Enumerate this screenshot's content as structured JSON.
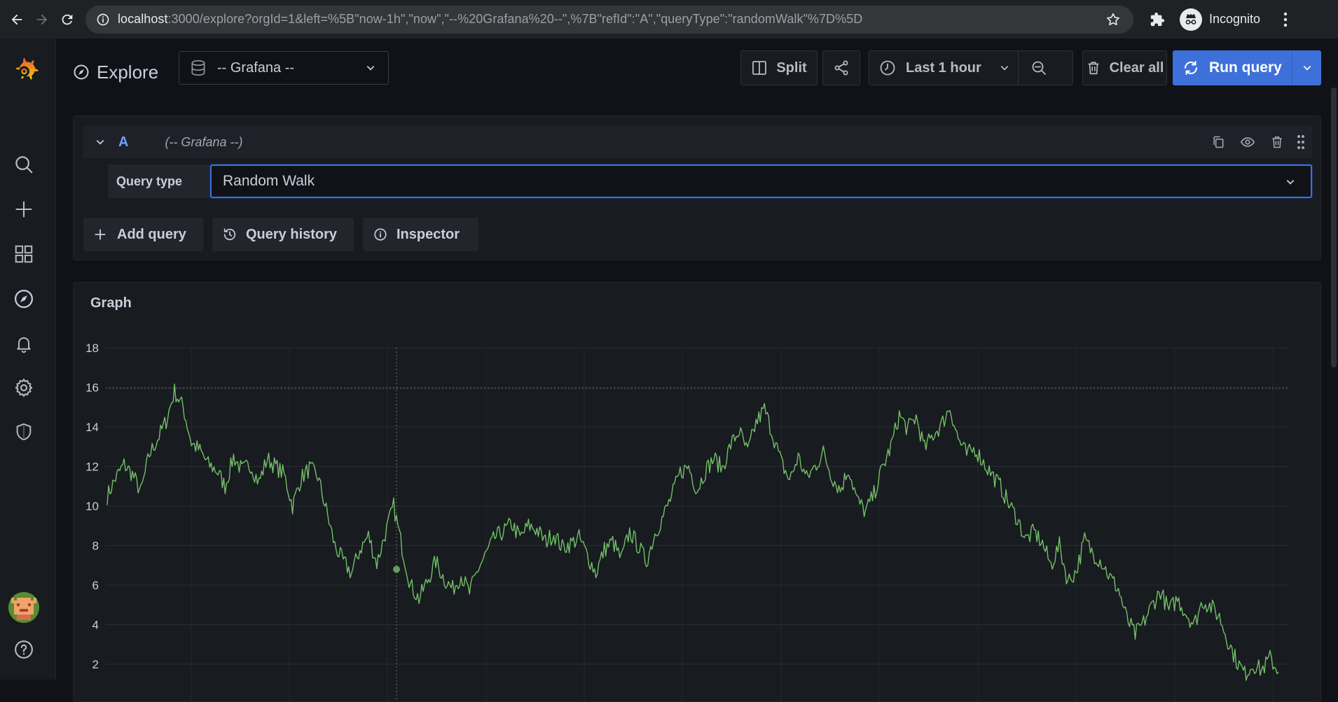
{
  "browser": {
    "url_host": "localhost",
    "url_rest": ":3000/explore?orgId=1&left=%5B\"now-1h\",\"now\",\"--%20Grafana%20--\",%7B\"refId\":\"A\",\"queryType\":\"randomWalk\"%7D%5D",
    "profile_label": "Incognito"
  },
  "header": {
    "title": "Explore",
    "datasource": "-- Grafana --",
    "split_label": "Split",
    "time_range_label": "Last 1 hour",
    "clear_all_label": "Clear all",
    "run_query_label": "Run query"
  },
  "query": {
    "ref_id": "A",
    "datasource_hint": "(-- Grafana --)",
    "query_type_label": "Query type",
    "query_type_value": "Random Walk",
    "add_query_label": "Add query",
    "query_history_label": "Query history",
    "inspector_label": "Inspector"
  },
  "graph": {
    "title": "Graph"
  },
  "colors": {
    "accent": "#3d71d9",
    "series": "#73bf69",
    "refid": "#6e9fff"
  },
  "chart_data": {
    "type": "line",
    "title": "Graph",
    "xlabel": "",
    "ylabel": "",
    "ylim": [
      1,
      18
    ],
    "yticks": [
      2,
      4,
      6,
      8,
      10,
      12,
      14,
      16,
      18
    ],
    "grid": true,
    "legend": "none",
    "series": [
      {
        "color": "#73bf69",
        "values": [
          10.5,
          11.4,
          12.1,
          11.6,
          10.7,
          12.6,
          13.4,
          14.3,
          15.8,
          15.0,
          13.2,
          12.8,
          12.1,
          11.8,
          11.0,
          12.5,
          11.8,
          12.1,
          11.2,
          12.4,
          12.0,
          11.6,
          10.0,
          11.4,
          11.9,
          11.5,
          9.8,
          8.0,
          7.2,
          6.6,
          7.8,
          8.5,
          7.1,
          8.6,
          10.0,
          7.9,
          6.0,
          5.3,
          6.2,
          7.2,
          6.3,
          5.8,
          6.5,
          5.6,
          6.8,
          7.6,
          8.4,
          8.7,
          9.1,
          8.4,
          9.0,
          8.8,
          8.2,
          8.6,
          7.9,
          8.1,
          8.4,
          7.5,
          6.6,
          7.8,
          8.2,
          7.3,
          8.7,
          8.0,
          7.2,
          8.6,
          9.5,
          10.5,
          11.7,
          12.0,
          10.8,
          11.8,
          12.4,
          11.9,
          13.1,
          13.8,
          12.7,
          14.2,
          14.9,
          13.6,
          12.2,
          11.3,
          12.5,
          11.4,
          12.0,
          12.7,
          11.5,
          10.8,
          11.9,
          10.3,
          9.7,
          10.6,
          11.9,
          13.0,
          14.6,
          13.9,
          14.5,
          12.9,
          13.6,
          14.1,
          15.0,
          13.4,
          12.6,
          12.9,
          12.2,
          11.6,
          11.0,
          10.1,
          9.4,
          8.3,
          8.7,
          8.1,
          7.0,
          8.0,
          6.2,
          6.7,
          8.3,
          7.6,
          7.2,
          6.4,
          5.8,
          4.3,
          3.5,
          4.1,
          5.0,
          5.7,
          4.7,
          5.3,
          4.6,
          4.0,
          5.2,
          4.9,
          4.4,
          3.2,
          2.2,
          1.5,
          2.0,
          1.7,
          2.3,
          1.6
        ]
      }
    ]
  }
}
